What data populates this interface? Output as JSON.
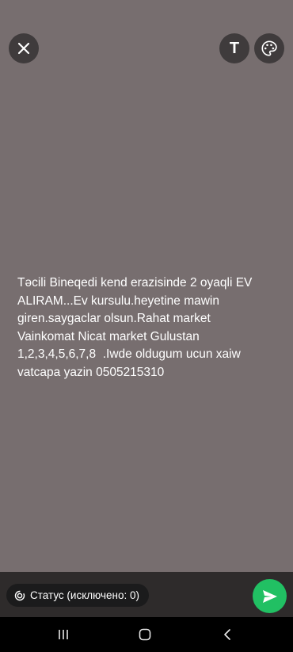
{
  "header": {
    "text_tool_label": "T"
  },
  "status_text": "Təcili Bineqedi kend erazisinde 2 oyaqli EV\nALIRAM...Ev kursulu.heyetine mawin\ngiren.saygaclar olsun.Rahat market\nVainkomat Nicat market Gulustan\n1,2,3,4,5,6,7,8  .Iwde oldugum ucun xaiw\nvatcapa yazin 0505215310",
  "footer": {
    "privacy_label": "Статус (исключено: 0)"
  },
  "icons": {
    "close": "close-icon",
    "palette": "palette-icon",
    "privacy": "status-privacy-icon",
    "send": "send-icon",
    "recents": "recents-icon",
    "home": "home-icon",
    "back": "back-icon"
  },
  "colors": {
    "background": "#776e6f",
    "send_button": "#21c063",
    "bottom_bar": "#2e2b2b"
  }
}
